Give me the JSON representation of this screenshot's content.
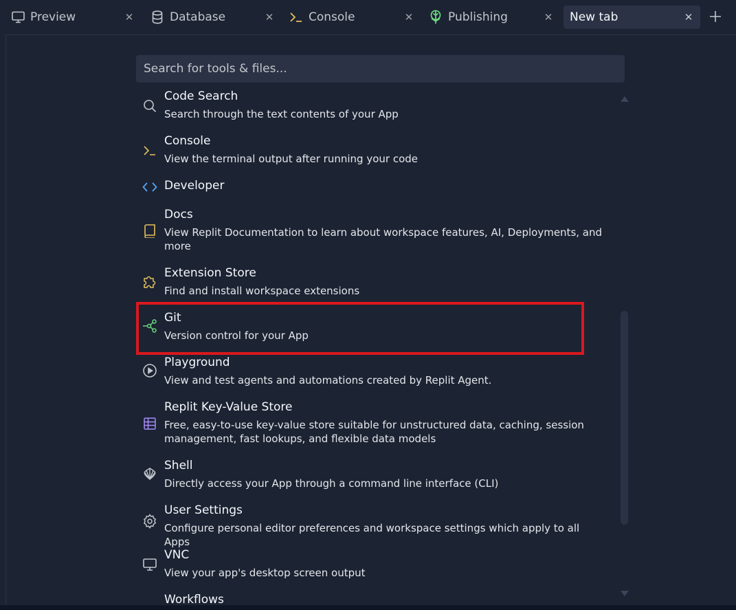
{
  "tabs": [
    {
      "label": "Preview",
      "icon": "monitor-icon"
    },
    {
      "label": "Database",
      "icon": "database-icon"
    },
    {
      "label": "Console",
      "icon": "terminal-icon"
    },
    {
      "label": "Publishing",
      "icon": "publishing-icon"
    },
    {
      "label": "New tab",
      "icon": "",
      "active": true
    }
  ],
  "search": {
    "placeholder": "Search for tools & files..."
  },
  "tools": [
    {
      "title": "Code Search",
      "description": "Search through the text contents of your App",
      "icon": "search-icon"
    },
    {
      "title": "Console",
      "description": "View the terminal output after running your code",
      "icon": "terminal-icon"
    },
    {
      "title": "Developer",
      "description": "",
      "icon": "code-icon"
    },
    {
      "title": "Docs",
      "description": "View Replit Documentation to learn about workspace features, AI, Deployments, and more",
      "icon": "book-icon"
    },
    {
      "title": "Extension Store",
      "description": "Find and install workspace extensions",
      "icon": "puzzle-icon"
    },
    {
      "title": "Git",
      "description": "Version control for your App",
      "icon": "git-icon"
    },
    {
      "title": "Playground",
      "description": "View and test agents and automations created by Replit Agent.",
      "icon": "play-circle-icon"
    },
    {
      "title": "Replit Key-Value Store",
      "description": "Free, easy-to-use key-value store suitable for unstructured data, caching, session management, fast lookups, and flexible data models",
      "icon": "table-icon"
    },
    {
      "title": "Shell",
      "description": "Directly access your App through a command line interface (CLI)",
      "icon": "shell-icon"
    },
    {
      "title": "User Settings",
      "description": "Configure personal editor preferences and workspace settings which apply to all Apps",
      "icon": "gear-icon"
    },
    {
      "title": "VNC",
      "description": "View your app's desktop screen output",
      "icon": "monitor-icon"
    },
    {
      "title": "Workflows",
      "description": "",
      "icon": "workflow-icon"
    }
  ],
  "colors": {
    "background": "#1c2333",
    "surface": "#2b3245",
    "highlight": "#d9181e",
    "console_accent": "#e5c15b",
    "code_accent": "#57abff",
    "git_accent": "#6cd97e",
    "kv_accent": "#a78bfa"
  }
}
